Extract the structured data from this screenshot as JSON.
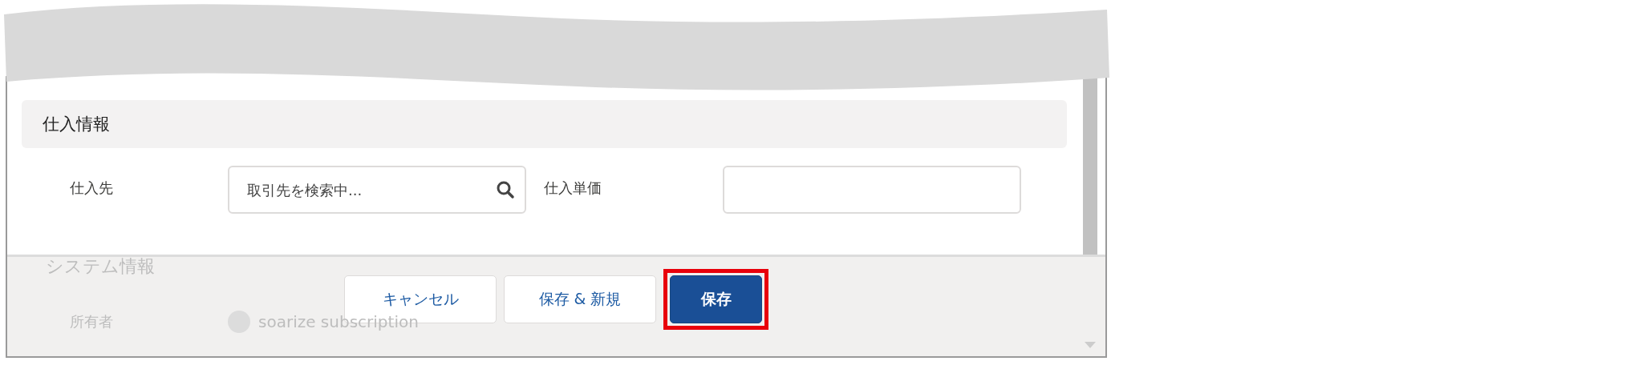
{
  "sections": [
    {
      "title": "仕入情報",
      "fields": [
        {
          "label": "仕入先",
          "kind": "lookup",
          "placeholder": "取引先を検索中..."
        },
        {
          "label": "仕入単価",
          "kind": "text"
        }
      ]
    }
  ],
  "behind_footer": {
    "section_title": "システム情報",
    "owner_label": "所有者",
    "owner_value": "soarize subscription"
  },
  "footer": {
    "buttons": [
      {
        "label": "キャンセル",
        "kind": "neutral",
        "highlighted": false
      },
      {
        "label": "保存 & 新規",
        "kind": "neutral",
        "highlighted": false
      },
      {
        "label": "保存",
        "kind": "brand",
        "highlighted": true
      }
    ]
  }
}
